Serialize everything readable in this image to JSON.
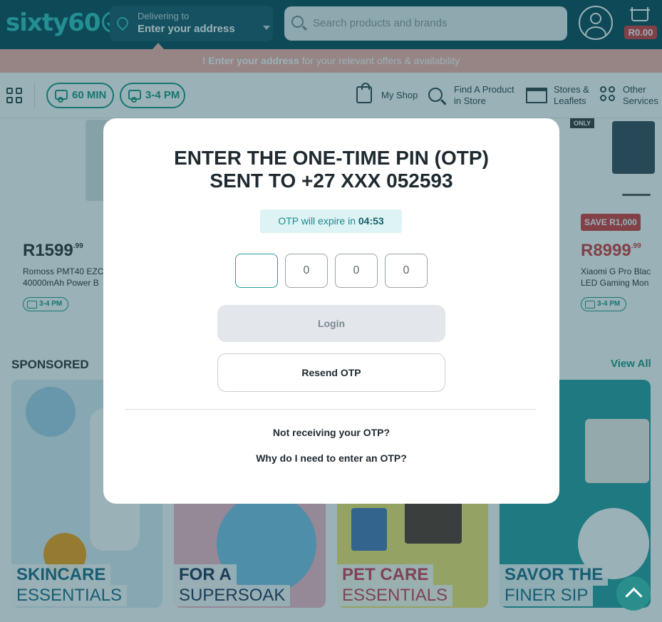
{
  "header": {
    "logo": "sixty60",
    "delivering_label": "Delivering to",
    "address_placeholder": "Enter your address",
    "search_placeholder": "Search products and brands",
    "cart_total": "R0.00"
  },
  "banner": {
    "bold": "! Enter your address",
    "rest": " for your relevant offers & availability"
  },
  "nav": {
    "pill_60": "60 MIN",
    "pill_34": "3-4 PM",
    "my_shop": "My Shop",
    "find_product": [
      "Find A Product",
      "in Store"
    ],
    "stores": [
      "Stores &",
      "Leaflets"
    ],
    "other": [
      "Other",
      "Services"
    ]
  },
  "products": [
    {
      "price_main": "R1599",
      "price_cents": ".99",
      "name_lines": [
        "Romoss PMT40 EZC",
        "40000mAh Power B"
      ],
      "delivery_tag": "3-4 PM"
    },
    {
      "badge": "SAVE R1,000",
      "only_badge": "ONLY",
      "price_main": "R8999",
      "price_cents": ".99",
      "name_lines": [
        "Xiaomi G Pro Blac",
        "LED Gaming Mon"
      ],
      "delivery_tag": "3-4 PM"
    }
  ],
  "sponsored": {
    "title": "SPONSORED",
    "view_all": "View All",
    "tiles": [
      {
        "line1": "SKINCARE",
        "line2": "ESSENTIALS",
        "color": "#1f6f8b"
      },
      {
        "line1": "FOR A",
        "line2": "SUPERSOAK",
        "color": "#203a5c"
      },
      {
        "line1": "PET CARE",
        "line2": "ESSENTIALS",
        "color": "#d43f5a"
      },
      {
        "line1": "SAVOR THE",
        "line2": "FINER SIP",
        "color": "#1f6f8b"
      }
    ]
  },
  "modal": {
    "title_line1": "ENTER THE ONE-TIME PIN (OTP)",
    "title_line2": "SENT TO +27 XXX 052593",
    "expiry_label": "OTP will expire in ",
    "expiry_time": "04:53",
    "otp_digits": [
      "",
      "0",
      "0",
      "0"
    ],
    "login_label": "Login",
    "resend_label": "Resend OTP",
    "not_receiving": "Not receiving your OTP?",
    "why_otp": "Why do I need to enter an OTP?"
  },
  "colors": {
    "brand_teal": "#34c3c0",
    "header_bg": "#0f4c5c",
    "accent_green": "#1e9a86",
    "sale_red": "#d43f3f"
  }
}
